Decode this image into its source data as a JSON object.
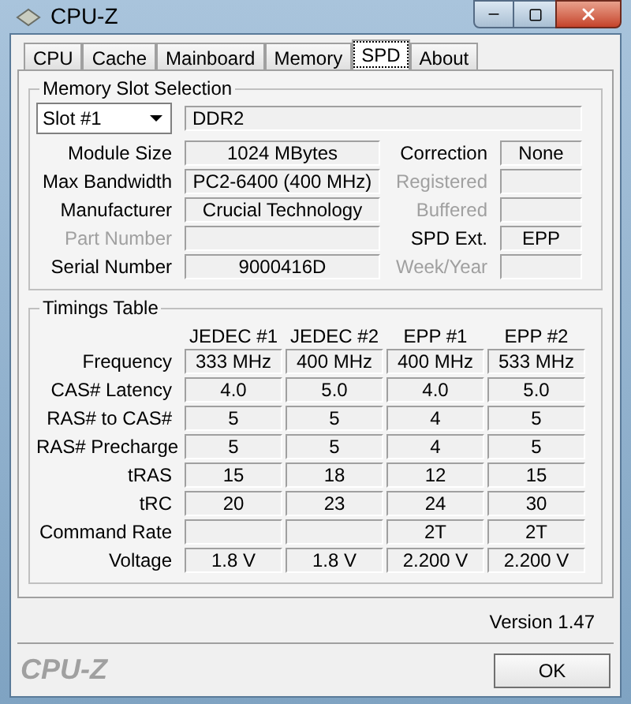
{
  "window": {
    "title": "CPU-Z"
  },
  "tabs": [
    {
      "label": "CPU",
      "selected": false
    },
    {
      "label": "Cache",
      "selected": false
    },
    {
      "label": "Mainboard",
      "selected": false
    },
    {
      "label": "Memory",
      "selected": false
    },
    {
      "label": "SPD",
      "selected": true
    },
    {
      "label": "About",
      "selected": false
    }
  ],
  "memory_slot_selection": {
    "title": "Memory Slot Selection",
    "slot_dropdown": {
      "value": "Slot #1"
    },
    "memory_type": "DDR2",
    "left_fields": [
      {
        "label": "Module Size",
        "value": "1024 MBytes",
        "disabled": false
      },
      {
        "label": "Max Bandwidth",
        "value": "PC2-6400 (400 MHz)",
        "disabled": false
      },
      {
        "label": "Manufacturer",
        "value": "Crucial Technology",
        "disabled": false
      },
      {
        "label": "Part Number",
        "disabled": true
      },
      {
        "label": "Serial Number",
        "value": "9000416D",
        "disabled": false
      }
    ],
    "right_fields": [
      {
        "label": "Correction",
        "value": "None",
        "disabled": false
      },
      {
        "label": "Registered",
        "disabled": true
      },
      {
        "label": "Buffered",
        "disabled": true
      },
      {
        "label": "SPD Ext.",
        "value": "EPP",
        "disabled": false
      },
      {
        "label": "Week/Year",
        "disabled": true
      }
    ]
  },
  "timings_table": {
    "title": "Timings Table",
    "columns": [
      "JEDEC #1",
      "JEDEC #2",
      "EPP #1",
      "EPP #2"
    ],
    "rows": [
      {
        "label": "Frequency",
        "cells": [
          {
            "value": "333 MHz"
          },
          {
            "value": "400 MHz"
          },
          {
            "value": "400 MHz"
          },
          {
            "value": "533 MHz"
          }
        ]
      },
      {
        "label": "CAS# Latency",
        "cells": [
          {
            "value": "4.0"
          },
          {
            "value": "5.0"
          },
          {
            "value": "4.0"
          },
          {
            "value": "5.0"
          }
        ]
      },
      {
        "label": "RAS# to CAS#",
        "cells": [
          {
            "value": "5"
          },
          {
            "value": "5"
          },
          {
            "value": "4"
          },
          {
            "value": "5"
          }
        ]
      },
      {
        "label": "RAS# Precharge",
        "cells": [
          {
            "value": "5"
          },
          {
            "value": "5"
          },
          {
            "value": "4"
          },
          {
            "value": "5"
          }
        ]
      },
      {
        "label": "tRAS",
        "cells": [
          {
            "value": "15"
          },
          {
            "value": "18"
          },
          {
            "value": "12"
          },
          {
            "value": "15"
          }
        ]
      },
      {
        "label": "tRC",
        "cells": [
          {
            "value": "20"
          },
          {
            "value": "23"
          },
          {
            "value": "24"
          },
          {
            "value": "30"
          }
        ]
      },
      {
        "label": "Command Rate",
        "cells": [
          {},
          {},
          {
            "value": "2T"
          },
          {
            "value": "2T"
          }
        ]
      },
      {
        "label": "Voltage",
        "cells": [
          {
            "value": "1.8 V"
          },
          {
            "value": "1.8 V"
          },
          {
            "value": "2.200 V"
          },
          {
            "value": "2.200 V"
          }
        ]
      }
    ]
  },
  "version": "Version 1.47",
  "footer": {
    "logo": "CPU-Z",
    "ok_button": "OK"
  }
}
